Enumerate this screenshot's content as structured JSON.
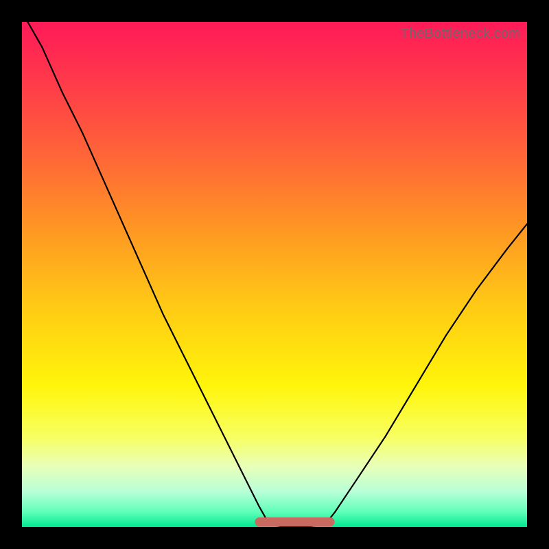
{
  "watermark": "TheBottleneck.com",
  "chart_data": {
    "type": "line",
    "title": "",
    "xlabel": "",
    "ylabel": "",
    "xlim": [
      0,
      1
    ],
    "ylim": [
      0,
      1
    ],
    "series": [
      {
        "name": "bottleneck-curve",
        "x": [
          0.0,
          0.04,
          0.08,
          0.12,
          0.16,
          0.2,
          0.24,
          0.28,
          0.32,
          0.36,
          0.4,
          0.44,
          0.47,
          0.49,
          0.52,
          0.56,
          0.6,
          0.62,
          0.66,
          0.72,
          0.78,
          0.84,
          0.9,
          0.96,
          1.0
        ],
        "y": [
          1.02,
          0.95,
          0.86,
          0.78,
          0.69,
          0.6,
          0.51,
          0.42,
          0.34,
          0.26,
          0.18,
          0.1,
          0.04,
          0.005,
          0.0,
          0.0,
          0.005,
          0.03,
          0.09,
          0.18,
          0.28,
          0.38,
          0.47,
          0.55,
          0.6
        ]
      }
    ],
    "highlight_band": {
      "x_start": 0.47,
      "x_end": 0.61,
      "y": 0.01,
      "thickness": 0.018,
      "color": "#c86a60"
    },
    "gradient_stops": [
      {
        "pos": 0.0,
        "color": "#ff1a58"
      },
      {
        "pos": 0.28,
        "color": "#ff6a35"
      },
      {
        "pos": 0.56,
        "color": "#ffc915"
      },
      {
        "pos": 0.82,
        "color": "#f8ff60"
      },
      {
        "pos": 1.0,
        "color": "#00e890"
      }
    ]
  }
}
